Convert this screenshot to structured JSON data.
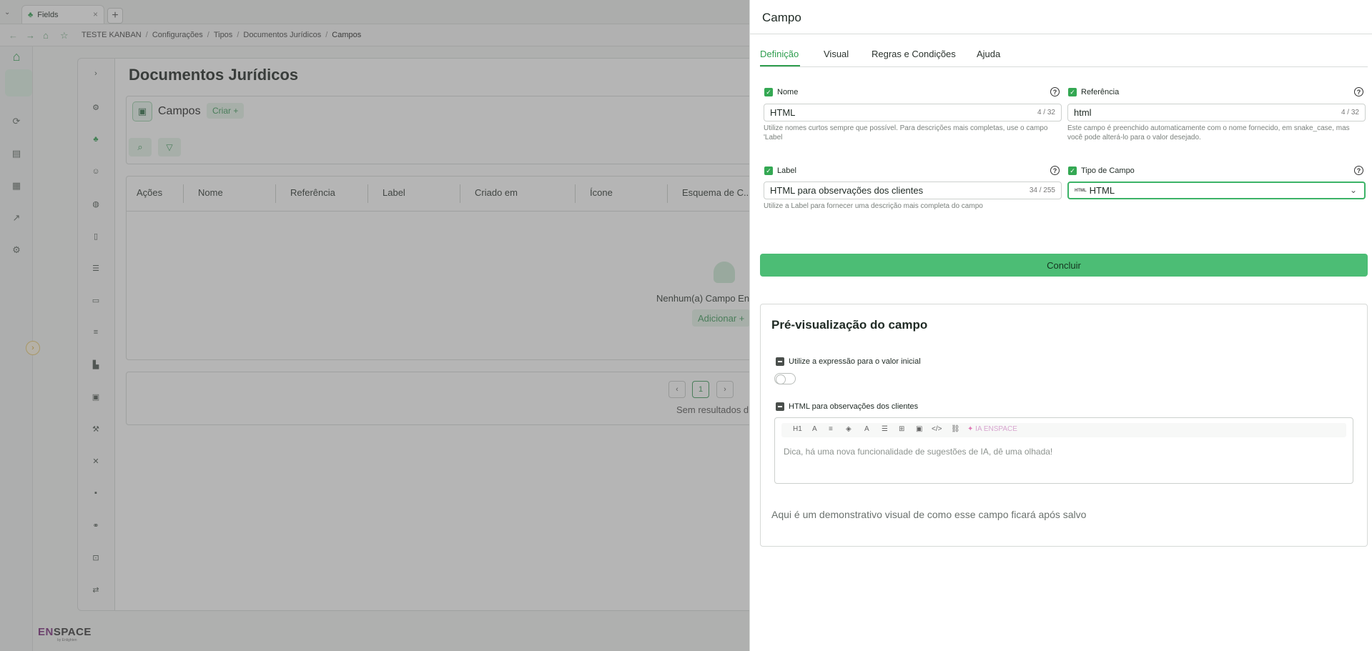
{
  "browser": {
    "tab_title": "Fields",
    "new_tab": "+",
    "breadcrumbs": [
      "TESTE KANBAN",
      "Configurações",
      "Tipos",
      "Documentos Jurídicos",
      "Campos"
    ],
    "breadcrumb_sep": "/"
  },
  "page": {
    "title": "Documentos Jurídicos",
    "section_title": "Campos",
    "create_label": "Criar +",
    "table_headers": [
      "Ações",
      "Nome",
      "Referência",
      "Label",
      "Criado em",
      "Ícone",
      "Esquema de C..."
    ],
    "empty_text": "Nenhum(a) Campo Enc",
    "add_label": "Adicionar +",
    "pager": {
      "prev": "‹",
      "current": "1",
      "next": "›"
    },
    "no_results": "Sem resultados d"
  },
  "logo": {
    "text_e": "EN",
    "text_rest": "SPACE",
    "sub": "by Enlighten"
  },
  "drawer": {
    "title": "Campo",
    "tabs": [
      "Definição",
      "Visual",
      "Regras e Condições",
      "Ajuda"
    ],
    "active_tab": "Definição",
    "nome": {
      "label": "Nome",
      "value": "HTML",
      "counter": "4 / 32",
      "hint": "Utilize nomes curtos sempre que possível. Para descrições mais completas, use o campo 'Label"
    },
    "referencia": {
      "label": "Referência",
      "value": "html",
      "counter": "4 / 32",
      "hint": "Este campo é preenchido automaticamente com o nome fornecido, em snake_case, mas você pode alterá-lo para o valor desejado."
    },
    "label": {
      "label": "Label",
      "value": "HTML para observações dos clientes",
      "counter": "34 / 255",
      "hint": "Utilize a Label para fornecer uma descrição mais completa do campo"
    },
    "tipo": {
      "label": "Tipo de Campo",
      "value": "HTML",
      "icon_text": "HTML"
    },
    "help_glyph": "?",
    "concluir": "Concluir",
    "preview": {
      "title": "Pré-visualização do campo",
      "expr_label": "Utilize a expressão para o valor inicial",
      "expr_toggle": false,
      "field_label": "HTML para observações dos clientes",
      "toolbar": [
        "H1",
        "A",
        "≡",
        "◈",
        "A",
        "☰",
        "⊞",
        "▣",
        "</>",
        "⛓"
      ],
      "ia_label": "IA ENSPACE",
      "editor_placeholder": "Dica, há uma nova funcionalidade de sugestões de IA, dê uma olhada!",
      "demo_text": "Aqui é um demonstrativo visual de como esse campo ficará após salvo"
    }
  },
  "colors": {
    "accent": "#34a853",
    "button_green": "#4cbd75",
    "overlay": "rgba(90,90,90,0.45)"
  }
}
